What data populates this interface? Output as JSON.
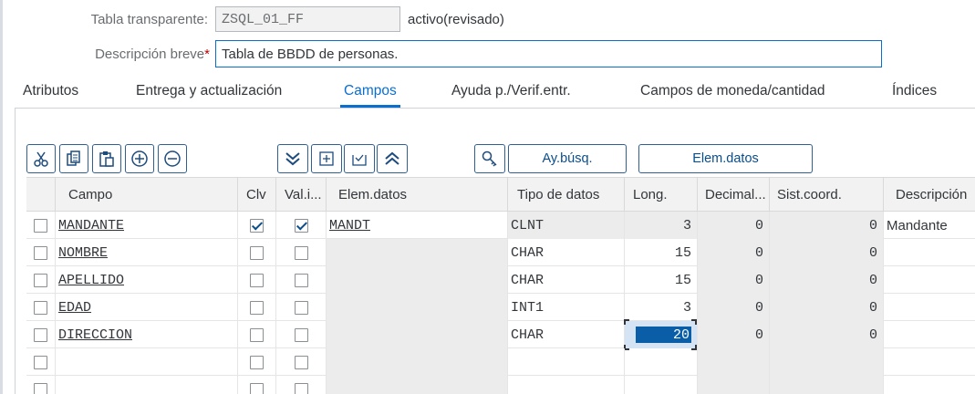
{
  "header": {
    "table_label": "Tabla transparente:",
    "table_value": "ZSQL_01_FF",
    "status": "activo(revisado)",
    "desc_label": "Descripción breve",
    "desc_required": "*",
    "desc_value": "Tabla de BBDD de personas."
  },
  "tabs": [
    {
      "label": "Atributos"
    },
    {
      "label": "Entrega y actualización"
    },
    {
      "label": "Campos",
      "active": true
    },
    {
      "label": "Ayuda p./Verif.entr."
    },
    {
      "label": "Campos de moneda/cantidad"
    },
    {
      "label": "Índices"
    }
  ],
  "toolbar": {
    "icons": [
      "cut-icon",
      "copy-icon",
      "paste-icon",
      "insert-row-icon",
      "delete-row-icon",
      "scroll-down-icon",
      "insert-field-icon",
      "check-list-icon",
      "scroll-up-icon",
      "search-key-icon"
    ],
    "search_help_label": "Ay.búsq.",
    "data_element_label": "Elem.datos"
  },
  "grid": {
    "columns": [
      "Campo",
      "Clv",
      "Val.i...",
      "Elem.datos",
      "Tipo de datos",
      "Long.",
      "Decimal...",
      "Sist.coord.",
      "Descripción"
    ],
    "rows": [
      {
        "campo": "MANDANTE",
        "clv": true,
        "vali": true,
        "elem": "MANDT",
        "tipo": "CLNT",
        "long": "3",
        "decimal": "0",
        "coord": "0",
        "desc": "Mandante"
      },
      {
        "campo": "NOMBRE",
        "clv": false,
        "vali": false,
        "elem": "",
        "tipo": "CHAR",
        "long": "15",
        "decimal": "0",
        "coord": "0",
        "desc": ""
      },
      {
        "campo": "APELLIDO",
        "clv": false,
        "vali": false,
        "elem": "",
        "tipo": "CHAR",
        "long": "15",
        "decimal": "0",
        "coord": "0",
        "desc": ""
      },
      {
        "campo": "EDAD",
        "clv": false,
        "vali": false,
        "elem": "",
        "tipo": "INT1",
        "long": "3",
        "decimal": "0",
        "coord": "0",
        "desc": ""
      },
      {
        "campo": "DIRECCION",
        "clv": false,
        "vali": false,
        "elem": "",
        "tipo": "CHAR",
        "long": "20",
        "decimal": "0",
        "coord": "0",
        "desc": "",
        "selected": true
      },
      {
        "campo": "",
        "clv": false,
        "vali": false,
        "elem": "",
        "tipo": "",
        "long": "",
        "decimal": "",
        "coord": "",
        "desc": ""
      },
      {
        "campo": "",
        "clv": false,
        "vali": false,
        "elem": "",
        "tipo": "",
        "long": "",
        "decimal": "",
        "coord": "",
        "desc": ""
      }
    ]
  },
  "colors": {
    "accent": "#0a6ed1",
    "selection": "#0a5ea8",
    "readonly_bg": "#ececec"
  }
}
